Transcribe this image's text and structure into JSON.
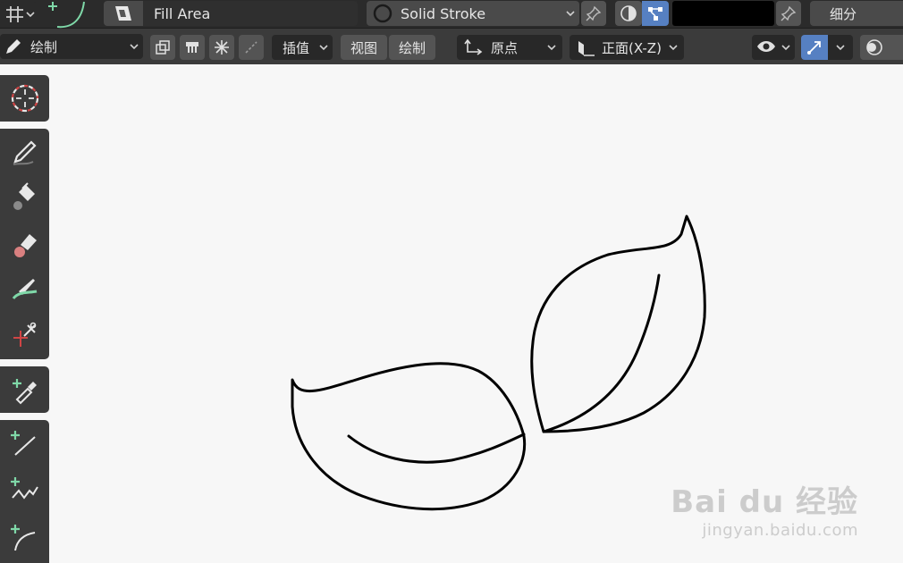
{
  "header": {
    "material_name": "Fill Area",
    "stroke_name": "Solid Stroke",
    "subdivide_label": "细分",
    "color_swatch": "#000000"
  },
  "toolbar": {
    "mode_label": "绘制",
    "interpolate_label": "插值",
    "view_label": "视图",
    "draw_label": "绘制",
    "origin_label": "原点",
    "plane_label": "正面(X-Z)"
  },
  "left_tools": [
    {
      "name": "cursor-tool",
      "icon": "cursor-icon"
    },
    {
      "name": "draw-tool",
      "icon": "pencil-icon"
    },
    {
      "name": "fill-tool",
      "icon": "bucket-icon"
    },
    {
      "name": "erase-tool",
      "icon": "eraser-icon"
    },
    {
      "name": "tint-tool",
      "icon": "brush-icon"
    },
    {
      "name": "cutter-tool",
      "icon": "scissors-icon"
    },
    {
      "name": "eyedropper-tool",
      "icon": "eyedropper-icon"
    },
    {
      "name": "line-tool",
      "icon": "line-icon"
    },
    {
      "name": "polyline-tool",
      "icon": "polyline-icon"
    },
    {
      "name": "arc-tool",
      "icon": "arc-icon"
    }
  ],
  "colors": {
    "accent_green": "#7fd8a8",
    "accent_blue": "#5680c2",
    "stroke": "#000000"
  },
  "watermark": {
    "main": "Bai du 经验",
    "sub": "jingyan.baidu.com"
  }
}
